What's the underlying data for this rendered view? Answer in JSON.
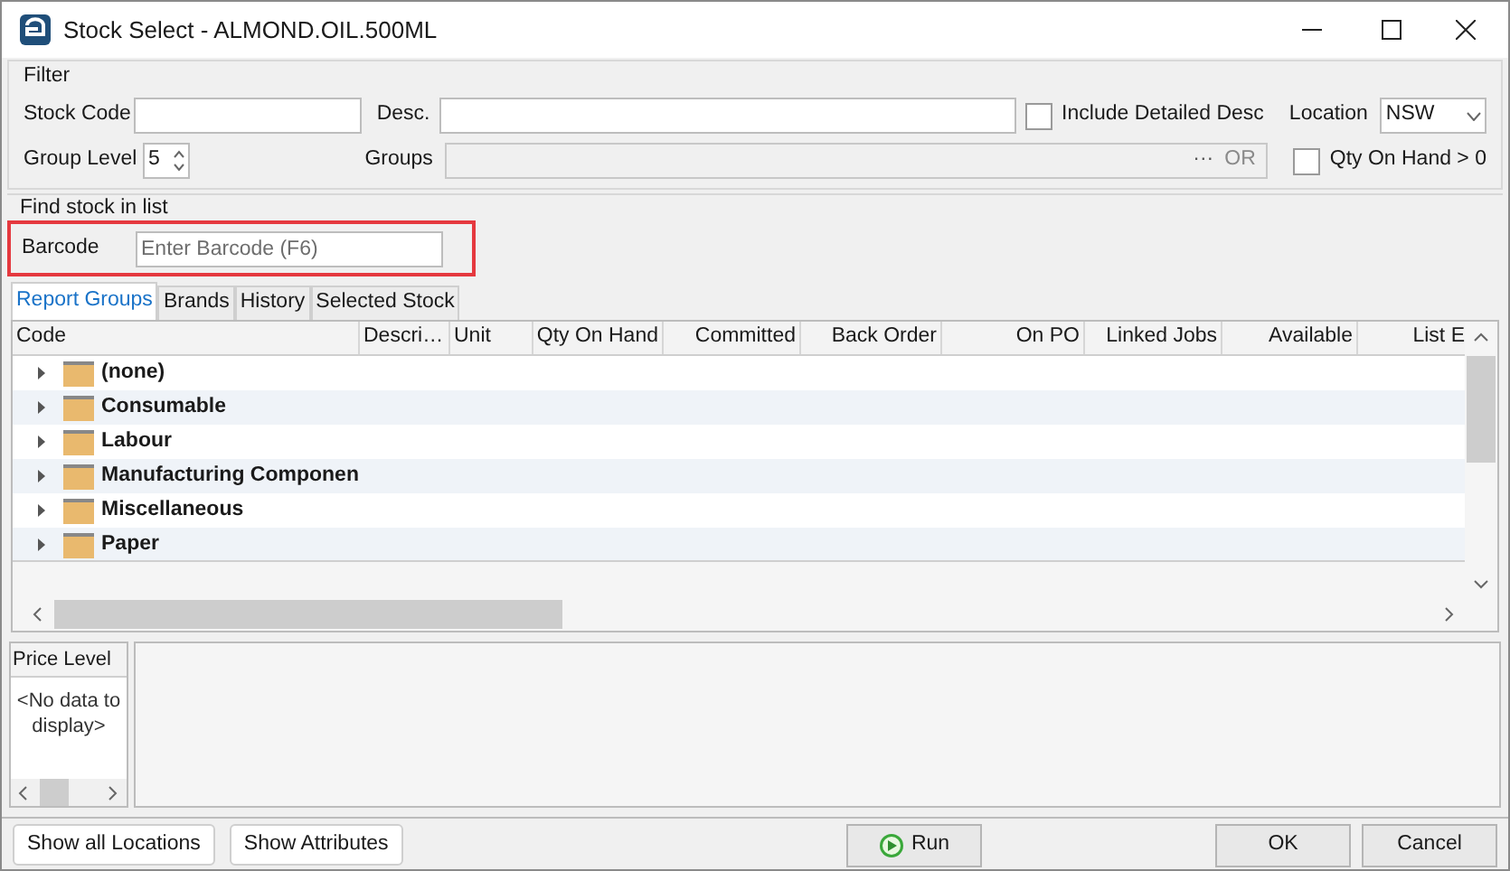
{
  "window": {
    "title": "Stock Select - ALMOND.OIL.500ML"
  },
  "filter": {
    "title": "Filter",
    "stock_code": {
      "label": "Stock Code"
    },
    "desc": {
      "label": "Desc."
    },
    "include_detailed_desc": {
      "label": "Include Detailed Desc",
      "checked": false
    },
    "location": {
      "label": "Location",
      "value": "NSW"
    },
    "group_level": {
      "label": "Group Level",
      "value": "5"
    },
    "groups": {
      "label": "Groups",
      "button": "···",
      "mode": "OR",
      "disabled": true
    },
    "qty_on_hand": {
      "label": "Qty On Hand > 0",
      "checked": false
    }
  },
  "find": {
    "title": "Find stock in list",
    "highlighted": true,
    "barcode": {
      "label": "Barcode",
      "placeholder": "Enter Barcode (F6)"
    }
  },
  "tabs": [
    {
      "label": "Report Groups",
      "selected": true
    },
    {
      "label": "Brands",
      "selected": false
    },
    {
      "label": "History",
      "selected": false
    },
    {
      "label": "Selected Stock",
      "selected": false
    }
  ],
  "table": {
    "columns": [
      "Code",
      "Descri…",
      "Unit",
      "Qty On Hand",
      "Committed",
      "Back Order",
      "On PO",
      "Linked Jobs",
      "Available",
      "List E"
    ],
    "rows": [
      {
        "code": "(none)",
        "expanded": false
      },
      {
        "code": "Consumable",
        "expanded": false
      },
      {
        "code": "Labour",
        "expanded": false
      },
      {
        "code": "Manufacturing Componen",
        "expanded": false
      },
      {
        "code": "Miscellaneous",
        "expanded": false
      },
      {
        "code": "Paper",
        "expanded": false
      }
    ]
  },
  "price_level": {
    "title": "Price Level",
    "empty": "<No data to display>"
  },
  "buttons_left": [
    "Show all Locations",
    "Show Attributes"
  ],
  "run_button": "Run",
  "buttons_right": [
    "OK",
    "Cancel"
  ]
}
